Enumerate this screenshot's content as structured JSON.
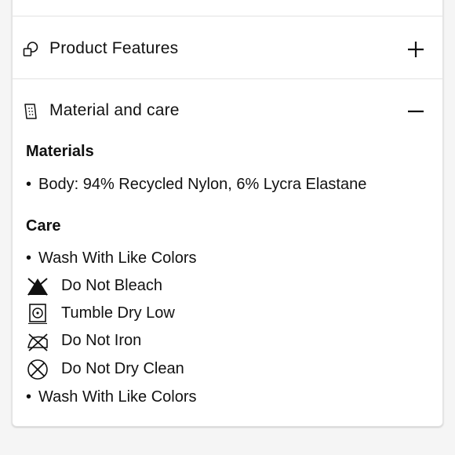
{
  "accordion": {
    "features": {
      "title": "Product Features",
      "icon": "product-features-icon",
      "toggle": "plus-icon",
      "expanded": false
    },
    "material": {
      "title": "Material and care",
      "icon": "material-tag-icon",
      "toggle": "minus-icon",
      "expanded": true
    }
  },
  "materials": {
    "heading": "Materials",
    "items": [
      "Body: 94% Recycled Nylon, 6% Lycra Elastane"
    ]
  },
  "care": {
    "heading": "Care",
    "items": [
      {
        "bullet": "•",
        "text": "Wash With Like Colors"
      },
      {
        "icon": "do-not-bleach-icon",
        "text": "Do Not Bleach"
      },
      {
        "icon": "tumble-dry-low-icon",
        "text": "Tumble Dry Low"
      },
      {
        "icon": "do-not-iron-icon",
        "text": "Do Not Iron"
      },
      {
        "icon": "do-not-dry-clean-icon",
        "text": "Do Not Dry Clean"
      },
      {
        "bullet": "•",
        "text": "Wash With Like Colors"
      }
    ]
  },
  "bullet": "•"
}
